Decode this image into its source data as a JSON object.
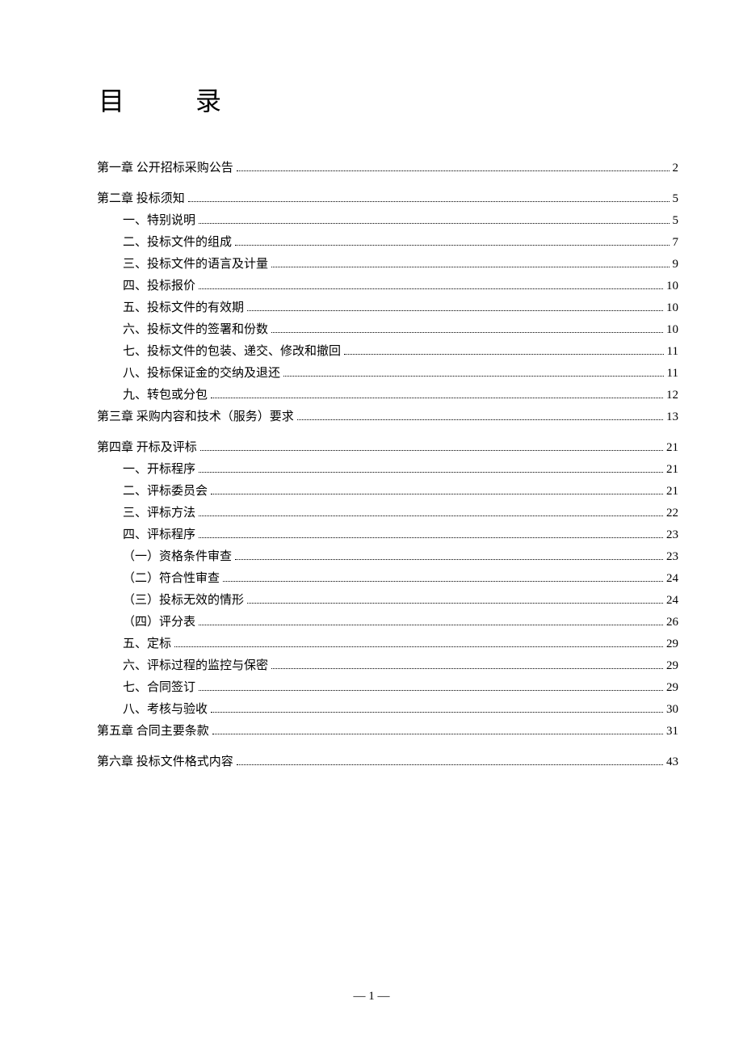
{
  "title": "目 录",
  "footer": "— 1 —",
  "toc": [
    {
      "label": "第一章 公开招标采购公告",
      "page": "2",
      "indent": 0,
      "spaced": true
    },
    {
      "label": "第二章 投标须知",
      "page": "5",
      "indent": 0,
      "spaced": false
    },
    {
      "label": "一、特别说明",
      "page": "5",
      "indent": 1,
      "spaced": false
    },
    {
      "label": "二、投标文件的组成",
      "page": "7",
      "indent": 1,
      "spaced": false
    },
    {
      "label": "三、投标文件的语言及计量",
      "page": "9",
      "indent": 1,
      "spaced": false
    },
    {
      "label": "四、投标报价",
      "page": "10",
      "indent": 1,
      "spaced": false
    },
    {
      "label": "五、投标文件的有效期",
      "page": "10",
      "indent": 1,
      "spaced": false
    },
    {
      "label": "六、投标文件的签署和份数",
      "page": "10",
      "indent": 1,
      "spaced": false
    },
    {
      "label": "七、投标文件的包装、递交、修改和撤回",
      "page": "11",
      "indent": 1,
      "spaced": false
    },
    {
      "label": "八、投标保证金的交纳及退还",
      "page": "11",
      "indent": 1,
      "spaced": false
    },
    {
      "label": "九、转包或分包",
      "page": "12",
      "indent": 1,
      "spaced": false
    },
    {
      "label": "第三章 采购内容和技术（服务）要求",
      "page": "13",
      "indent": 0,
      "spaced": true
    },
    {
      "label": "第四章 开标及评标",
      "page": "21",
      "indent": 0,
      "spaced": false
    },
    {
      "label": "一、开标程序",
      "page": "21",
      "indent": 1,
      "spaced": false
    },
    {
      "label": "二、评标委员会",
      "page": "21",
      "indent": 1,
      "spaced": false
    },
    {
      "label": "三、评标方法",
      "page": "22",
      "indent": 1,
      "spaced": false
    },
    {
      "label": "四、评标程序",
      "page": "23",
      "indent": 1,
      "spaced": false
    },
    {
      "label": "（一）资格条件审查",
      "page": "23",
      "indent": 2,
      "spaced": false
    },
    {
      "label": "（二）符合性审查",
      "page": "24",
      "indent": 2,
      "spaced": false
    },
    {
      "label": "（三）投标无效的情形",
      "page": "24",
      "indent": 2,
      "spaced": false
    },
    {
      "label": "（四）评分表",
      "page": "26",
      "indent": 2,
      "spaced": false
    },
    {
      "label": "五、定标",
      "page": "29",
      "indent": 1,
      "spaced": false
    },
    {
      "label": "六、评标过程的监控与保密",
      "page": "29",
      "indent": 1,
      "spaced": false
    },
    {
      "label": "七、合同签订",
      "page": "29",
      "indent": 1,
      "spaced": false
    },
    {
      "label": "八、考核与验收",
      "page": "30",
      "indent": 1,
      "spaced": false
    },
    {
      "label": "第五章 合同主要条款",
      "page": "31",
      "indent": 0,
      "spaced": true
    },
    {
      "label": "第六章 投标文件格式内容",
      "page": "43",
      "indent": 0,
      "spaced": false
    }
  ]
}
